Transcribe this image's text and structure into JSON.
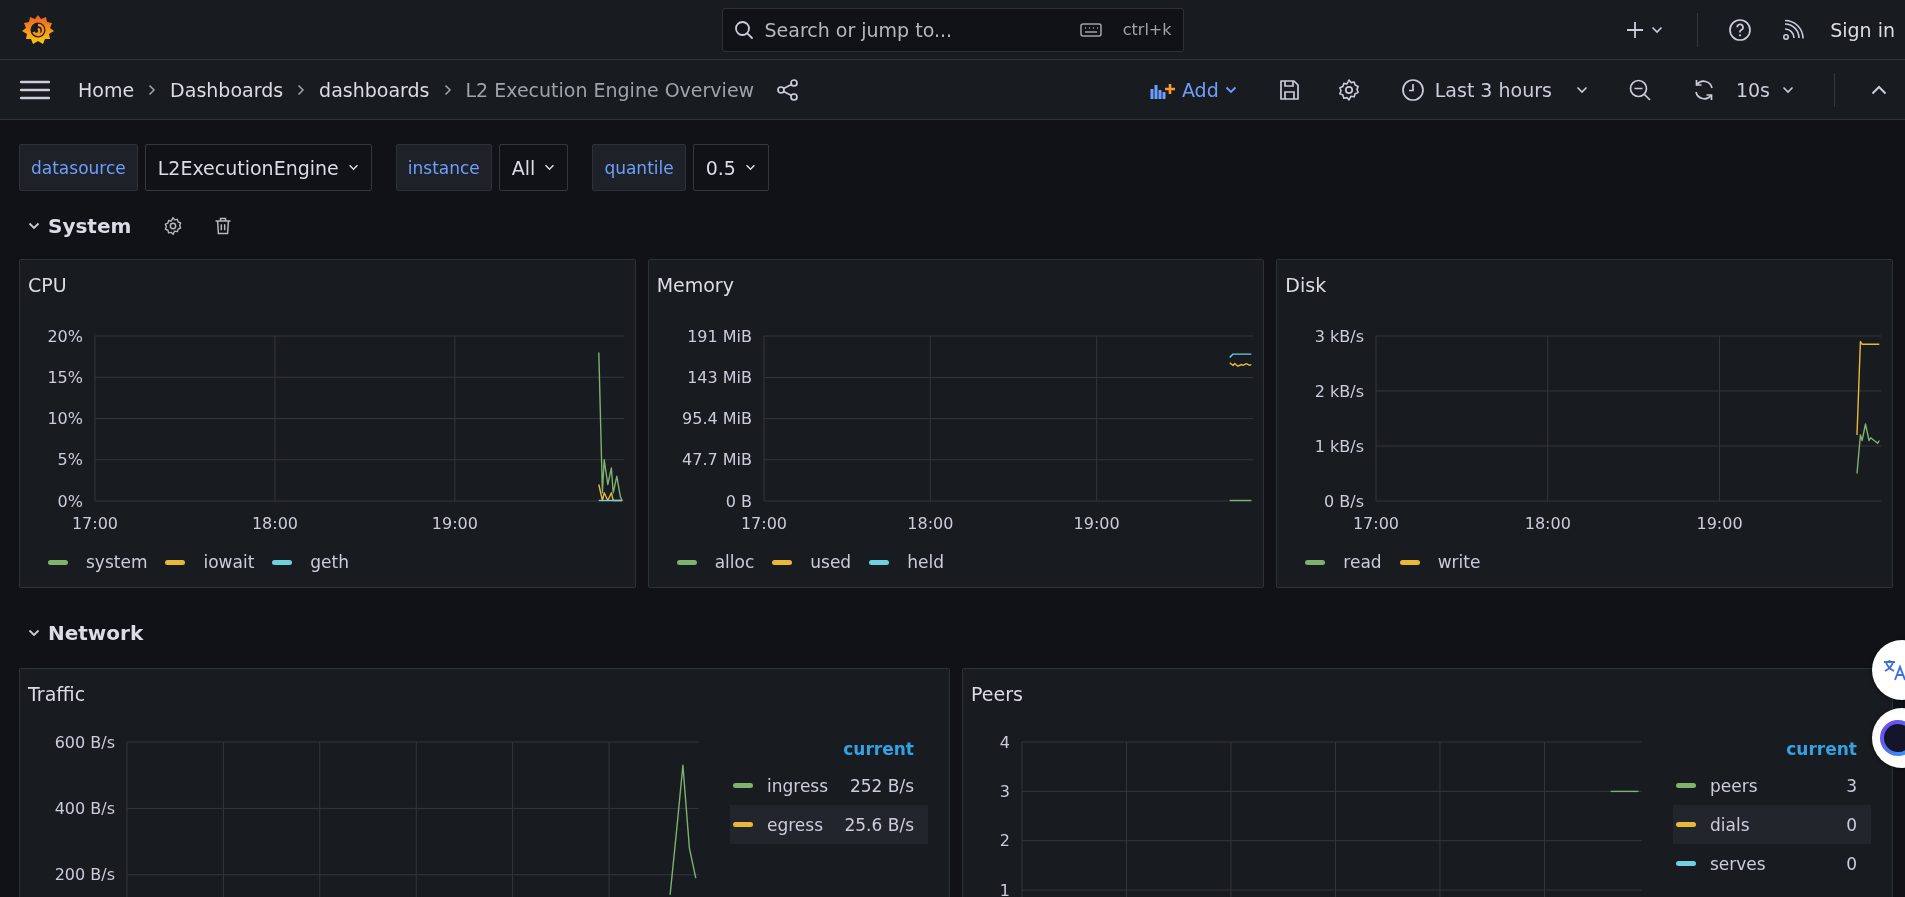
{
  "top_bar": {
    "search": {
      "placeholder": "Search or jump to...",
      "shortcut": "ctrl+k"
    },
    "sign_in": "Sign in"
  },
  "breadcrumbs": [
    {
      "label": "Home",
      "current": false
    },
    {
      "label": "Dashboards",
      "current": false
    },
    {
      "label": "dashboards",
      "current": false
    },
    {
      "label": "L2 Execution Engine Overview",
      "current": true
    }
  ],
  "toolbar": {
    "add": "Add",
    "time_range": "Last 3 hours",
    "refresh_interval": "10s"
  },
  "variables": [
    {
      "label": "datasource",
      "value": "L2ExecutionEngine"
    },
    {
      "label": "instance",
      "value": "All"
    },
    {
      "label": "quantile",
      "value": "0.5"
    }
  ],
  "rows": [
    {
      "title": "System",
      "expanded": true,
      "actions_visible": true,
      "panels": [
        {
          "title": "CPU",
          "legend": {
            "kind": "list"
          },
          "chart_data": {
            "type": "line",
            "grid": true,
            "x": [
              19.8,
              19.82,
              19.83,
              19.85,
              19.87,
              19.88,
              19.9,
              19.92,
              19.93
            ],
            "xlim": [
              17,
              19.94
            ],
            "ylim": [
              0,
              20
            ],
            "xticks": [
              {
                "value": 17,
                "label": "17:00"
              },
              {
                "value": 18,
                "label": "18:00"
              },
              {
                "value": 19,
                "label": "19:00"
              }
            ],
            "yticks": [
              {
                "value": 0,
                "label": "0%"
              },
              {
                "value": 5,
                "label": "5%"
              },
              {
                "value": 10,
                "label": "10%"
              },
              {
                "value": 15,
                "label": "15%"
              },
              {
                "value": 20,
                "label": "20%"
              }
            ],
            "series": [
              {
                "name": "system",
                "color": "#7eb26d",
                "values": [
                  18,
                  1,
                  5,
                  2,
                  4,
                  1,
                  3,
                  0.5,
                  0
                ]
              },
              {
                "name": "iowait",
                "color": "#eab839",
                "values": [
                  2,
                  0,
                  1,
                  0,
                  1,
                  0,
                  0,
                  0,
                  0
                ]
              },
              {
                "name": "geth",
                "color": "#6ed0e0",
                "values": [
                  0,
                  0,
                  0,
                  0,
                  0,
                  0,
                  0,
                  0,
                  0
                ]
              }
            ]
          }
        },
        {
          "title": "Memory",
          "legend": {
            "kind": "list"
          },
          "chart_data": {
            "type": "line",
            "grid": true,
            "x": [
              19.8,
              19.82,
              19.83,
              19.85,
              19.87,
              19.88,
              19.9,
              19.92,
              19.93
            ],
            "xlim": [
              17,
              19.94
            ],
            "ylim": [
              0,
              191
            ],
            "xticks": [
              {
                "value": 17,
                "label": "17:00"
              },
              {
                "value": 18,
                "label": "18:00"
              },
              {
                "value": 19,
                "label": "19:00"
              }
            ],
            "yticks": [
              {
                "value": 0,
                "label": "0 B"
              },
              {
                "value": 47.7,
                "label": "47.7 MiB"
              },
              {
                "value": 95.4,
                "label": "95.4 MiB"
              },
              {
                "value": 143,
                "label": "143 MiB"
              },
              {
                "value": 191,
                "label": "191 MiB"
              }
            ],
            "series": [
              {
                "name": "alloc",
                "color": "#7eb26d",
                "values": [
                  0,
                  0,
                  0,
                  0,
                  0,
                  0,
                  0,
                  0,
                  0
                ]
              },
              {
                "name": "used",
                "color": "#eab839",
                "values": [
                  160,
                  157,
                  159,
                  156,
                  158,
                  157,
                  159,
                  157,
                  158
                ]
              },
              {
                "name": "held",
                "color": "#6ed0e0",
                "values": [
                  166,
                  170,
                  170,
                  170,
                  170,
                  170,
                  170,
                  170,
                  170
                ]
              }
            ]
          }
        },
        {
          "title": "Disk",
          "legend": {
            "kind": "list"
          },
          "chart_data": {
            "type": "line",
            "grid": true,
            "x": [
              19.8,
              19.82,
              19.83,
              19.85,
              19.87,
              19.88,
              19.9,
              19.92,
              19.93
            ],
            "xlim": [
              17,
              19.94
            ],
            "ylim": [
              0,
              3
            ],
            "xticks": [
              {
                "value": 17,
                "label": "17:00"
              },
              {
                "value": 18,
                "label": "18:00"
              },
              {
                "value": 19,
                "label": "19:00"
              }
            ],
            "yticks": [
              {
                "value": 0,
                "label": "0 B/s"
              },
              {
                "value": 1,
                "label": "1 kB/s"
              },
              {
                "value": 2,
                "label": "2 kB/s"
              },
              {
                "value": 3,
                "label": "3 kB/s"
              }
            ],
            "series": [
              {
                "name": "read",
                "color": "#7eb26d",
                "values": [
                  0.5,
                  1.2,
                  1.1,
                  1.4,
                  1.1,
                  1.15,
                  1.1,
                  1.05,
                  1.1
                ]
              },
              {
                "name": "write",
                "color": "#eab839",
                "values": [
                  1.2,
                  2.9,
                  2.85,
                  2.85,
                  2.85,
                  2.85,
                  2.85,
                  2.85,
                  2.85
                ]
              }
            ]
          }
        }
      ]
    },
    {
      "title": "Network",
      "expanded": true,
      "actions_visible": false,
      "panels": [
        {
          "title": "Traffic",
          "legend": {
            "kind": "table",
            "header": "current",
            "values": [
              "252 B/s",
              "25.6 B/s"
            ]
          },
          "chart_data": {
            "type": "line",
            "grid": true,
            "categories": [
              null,
              null,
              null,
              null,
              null,
              null,
              null,
              null,
              null,
              null,
              null,
              null,
              null,
              null,
              null,
              null,
              null,
              null,
              null,
              null,
              null,
              null,
              null,
              null,
              null,
              null,
              null,
              null,
              null,
              null,
              null,
              null,
              null,
              null,
              null,
              null,
              null,
              null,
              null,
              null,
              null,
              null,
              null,
              null,
              null,
              null,
              null,
              null,
              null,
              null,
              null,
              null,
              null,
              null,
              null,
              null,
              null,
              null,
              null,
              null,
              null,
              null,
              null,
              null,
              null,
              null,
              null,
              null,
              null,
              null,
              null,
              null,
              null,
              null,
              null,
              null,
              null,
              null,
              null,
              null,
              null,
              null,
              null,
              null,
              null,
              null,
              null,
              null,
              null
            ],
            "ylim": [
              130,
              600
            ],
            "yticks": [
              {
                "value": 200,
                "label": "200 B/s"
              },
              {
                "value": 400,
                "label": "400 B/s"
              },
              {
                "value": 600,
                "label": "600 B/s"
              }
            ],
            "series": [
              {
                "name": "ingress",
                "color": "#7eb26d",
                "values": [
                  null,
                  null,
                  null,
                  null,
                  null,
                  null,
                  null,
                  null,
                  null,
                  null,
                  null,
                  null,
                  null,
                  null,
                  null,
                  null,
                  null,
                  null,
                  null,
                  null,
                  null,
                  null,
                  null,
                  null,
                  null,
                  null,
                  null,
                  null,
                  null,
                  null,
                  null,
                  null,
                  null,
                  null,
                  null,
                  null,
                  null,
                  null,
                  null,
                  null,
                  null,
                  null,
                  null,
                  null,
                  null,
                  null,
                  null,
                  null,
                  null,
                  null,
                  null,
                  null,
                  null,
                  null,
                  null,
                  null,
                  null,
                  null,
                  null,
                  null,
                  null,
                  null,
                  null,
                  null,
                  null,
                  null,
                  null,
                  null,
                  null,
                  null,
                  null,
                  null,
                  null,
                  null,
                  null,
                  null,
                  null,
                  null,
                  null,
                  null,
                  null,
                  null,
                  null,
                  null,
                  140,
                  330,
                  530,
                  280,
                  190
                ]
              },
              {
                "name": "egress",
                "color": "#eab839",
                "values": [
                  null,
                  null,
                  null,
                  null,
                  null,
                  null,
                  null,
                  null,
                  null,
                  null,
                  null,
                  null,
                  null,
                  null,
                  null,
                  null,
                  null,
                  null,
                  null,
                  null,
                  null,
                  null,
                  null,
                  null,
                  null,
                  null,
                  null,
                  null,
                  null,
                  null,
                  null,
                  null,
                  null,
                  null,
                  null,
                  null,
                  null,
                  null,
                  null,
                  null,
                  null,
                  null,
                  null,
                  null,
                  null,
                  null,
                  null,
                  null,
                  null,
                  null,
                  null,
                  null,
                  null,
                  null,
                  null,
                  null,
                  null,
                  null,
                  null,
                  null,
                  null,
                  null,
                  null,
                  null,
                  null,
                  null,
                  null,
                  null,
                  null,
                  null,
                  null,
                  null,
                  null,
                  null,
                  null,
                  null,
                  null,
                  null,
                  null,
                  null,
                  null,
                  null,
                  null,
                  null,
                  null,
                  null,
                  null,
                  null,
                  null
                ]
              }
            ]
          }
        },
        {
          "title": "Peers",
          "legend": {
            "kind": "table",
            "header": "current",
            "values": [
              "3",
              "0",
              "0"
            ]
          },
          "chart_data": {
            "type": "line",
            "grid": true,
            "categories": [
              null,
              null,
              null,
              null,
              null,
              null,
              null,
              null,
              null,
              null,
              null,
              null,
              null,
              null,
              null,
              null,
              null,
              null,
              null,
              null,
              null,
              null,
              null,
              null,
              null,
              null,
              null,
              null,
              null,
              null,
              null,
              null,
              null,
              null,
              null,
              null,
              null,
              null,
              null,
              null,
              null,
              null,
              null,
              null,
              null,
              null,
              null,
              null,
              null,
              null,
              null,
              null,
              null,
              null,
              null,
              null,
              null,
              null,
              null,
              null,
              null,
              null,
              null,
              null,
              null,
              null,
              null,
              null,
              null,
              null,
              null,
              null,
              null,
              null,
              null,
              null,
              null,
              null,
              null,
              null,
              null,
              null,
              null,
              null,
              null,
              null,
              null,
              null,
              null
            ],
            "ylim": [
              0.84,
              4
            ],
            "yticks": [
              {
                "value": 1,
                "label": "1"
              },
              {
                "value": 2,
                "label": "2"
              },
              {
                "value": 3,
                "label": "3"
              },
              {
                "value": 4,
                "label": "4"
              }
            ],
            "series": [
              {
                "name": "peers",
                "color": "#7eb26d",
                "values": [
                  null,
                  null,
                  null,
                  null,
                  null,
                  null,
                  null,
                  null,
                  null,
                  null,
                  null,
                  null,
                  null,
                  null,
                  null,
                  null,
                  null,
                  null,
                  null,
                  null,
                  null,
                  null,
                  null,
                  null,
                  null,
                  null,
                  null,
                  null,
                  null,
                  null,
                  null,
                  null,
                  null,
                  null,
                  null,
                  null,
                  null,
                  null,
                  null,
                  null,
                  null,
                  null,
                  null,
                  null,
                  null,
                  null,
                  null,
                  null,
                  null,
                  null,
                  null,
                  null,
                  null,
                  null,
                  null,
                  null,
                  null,
                  null,
                  null,
                  null,
                  null,
                  null,
                  null,
                  null,
                  null,
                  null,
                  null,
                  null,
                  null,
                  null,
                  null,
                  null,
                  null,
                  null,
                  null,
                  null,
                  null,
                  null,
                  null,
                  null,
                  null,
                  null,
                  null,
                  null,
                  3,
                  3,
                  3,
                  3,
                  3
                ]
              },
              {
                "name": "dials",
                "color": "#eab839",
                "values": [
                  null,
                  null,
                  null,
                  null,
                  null,
                  null,
                  null,
                  null,
                  null,
                  null,
                  null,
                  null,
                  null,
                  null,
                  null,
                  null,
                  null,
                  null,
                  null,
                  null,
                  null,
                  null,
                  null,
                  null,
                  null,
                  null,
                  null,
                  null,
                  null,
                  null,
                  null,
                  null,
                  null,
                  null,
                  null,
                  null,
                  null,
                  null,
                  null,
                  null,
                  null,
                  null,
                  null,
                  null,
                  null,
                  null,
                  null,
                  null,
                  null,
                  null,
                  null,
                  null,
                  null,
                  null,
                  null,
                  null,
                  null,
                  null,
                  null,
                  null,
                  null,
                  null,
                  null,
                  null,
                  null,
                  null,
                  null,
                  null,
                  null,
                  null,
                  null,
                  null,
                  null,
                  null,
                  null,
                  null,
                  null,
                  null,
                  null,
                  null,
                  null,
                  null,
                  null,
                  null,
                  null,
                  null,
                  null,
                  null,
                  null
                ]
              },
              {
                "name": "serves",
                "color": "#6ed0e0",
                "values": [
                  null,
                  null,
                  null,
                  null,
                  null,
                  null,
                  null,
                  null,
                  null,
                  null,
                  null,
                  null,
                  null,
                  null,
                  null,
                  null,
                  null,
                  null,
                  null,
                  null,
                  null,
                  null,
                  null,
                  null,
                  null,
                  null,
                  null,
                  null,
                  null,
                  null,
                  null,
                  null,
                  null,
                  null,
                  null,
                  null,
                  null,
                  null,
                  null,
                  null,
                  null,
                  null,
                  null,
                  null,
                  null,
                  null,
                  null,
                  null,
                  null,
                  null,
                  null,
                  null,
                  null,
                  null,
                  null,
                  null,
                  null,
                  null,
                  null,
                  null,
                  null,
                  null,
                  null,
                  null,
                  null,
                  null,
                  null,
                  null,
                  null,
                  null,
                  null,
                  null,
                  null,
                  null,
                  null,
                  null,
                  null,
                  null,
                  null,
                  null,
                  null,
                  null,
                  null,
                  null,
                  null,
                  null,
                  null,
                  null,
                  null
                ]
              }
            ]
          }
        }
      ]
    }
  ]
}
